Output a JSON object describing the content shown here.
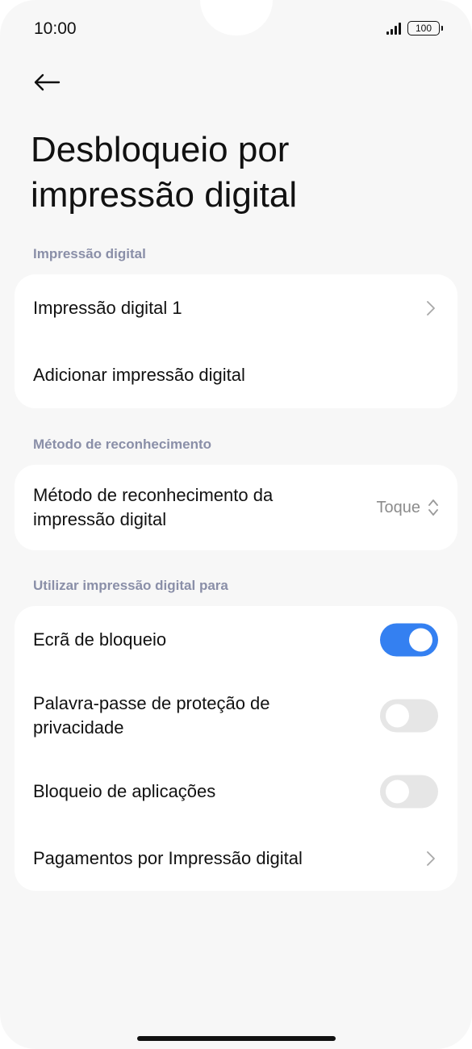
{
  "status_bar": {
    "time": "10:00",
    "battery": "100"
  },
  "header": {
    "back_icon": "arrow-left-icon",
    "title": "Desbloqueio por impressão digital"
  },
  "sections": {
    "fingerprint": {
      "header": "Impressão digital",
      "items": [
        {
          "label": "Impressão digital 1",
          "control": "chevron-right-icon"
        },
        {
          "label": "Adicionar impressão digital"
        }
      ]
    },
    "recognition": {
      "header": "Método de reconhecimento",
      "items": [
        {
          "label": "Método de reconhecimento da impressão digital",
          "value": "Toque",
          "control": "chevron-up-down-icon"
        }
      ]
    },
    "usage": {
      "header": "Utilizar impressão digital para",
      "items": [
        {
          "label": "Ecrã de bloqueio",
          "toggle_on": true
        },
        {
          "label": "Palavra-passe de proteção de privacidade",
          "toggle_on": false
        },
        {
          "label": "Bloqueio de aplicações",
          "toggle_on": false
        },
        {
          "label": "Pagamentos por Impressão digital",
          "control": "chevron-right-icon"
        }
      ]
    }
  },
  "colors": {
    "accent": "#3480f1",
    "toggle_off": "#e6e6e6",
    "section_header": "#8a8fa8",
    "background": "#f7f7f7",
    "card": "#ffffff"
  }
}
